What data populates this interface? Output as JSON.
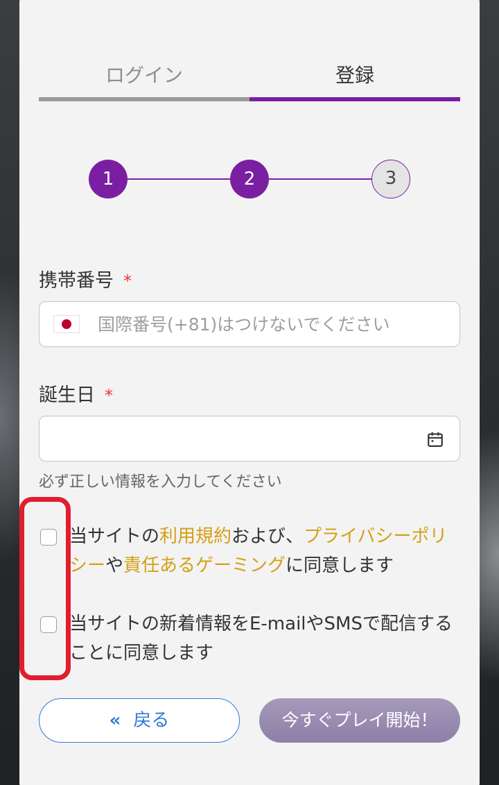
{
  "tabs": {
    "login": "ログイン",
    "register": "登録"
  },
  "steps": [
    "1",
    "2",
    "3"
  ],
  "phone": {
    "label": "携帯番号",
    "required_mark": "*",
    "placeholder": "国際番号(+81)はつけないでください",
    "value": ""
  },
  "birthday": {
    "label": "誕生日",
    "required_mark": "*",
    "value": "",
    "hint": "必ず正しい情報を入力してください"
  },
  "consent": {
    "terms": {
      "part1": "当サイトの",
      "link1": "利用規約",
      "part2": "および、",
      "link2": "プライバシーポリシー",
      "part3": "や",
      "link3": "責任あるゲーミング",
      "part4": "に同意します",
      "checked": false
    },
    "newsletter": {
      "text": "当サイトの新着情報をE-mailやSMSで配信することに同意します",
      "checked": false
    }
  },
  "buttons": {
    "back_icon": "«",
    "back": "戻る",
    "play": "今すぐプレイ開始！"
  },
  "colors": {
    "primary": "#7b1fa2",
    "link": "#d4a017",
    "back_button": "#2f7bd6",
    "highlight": "#e01e2e",
    "required": "#e53935"
  },
  "icons": {
    "flag": "japan-flag-icon",
    "calendar": "calendar-icon",
    "back": "double-chevron-left-icon"
  }
}
